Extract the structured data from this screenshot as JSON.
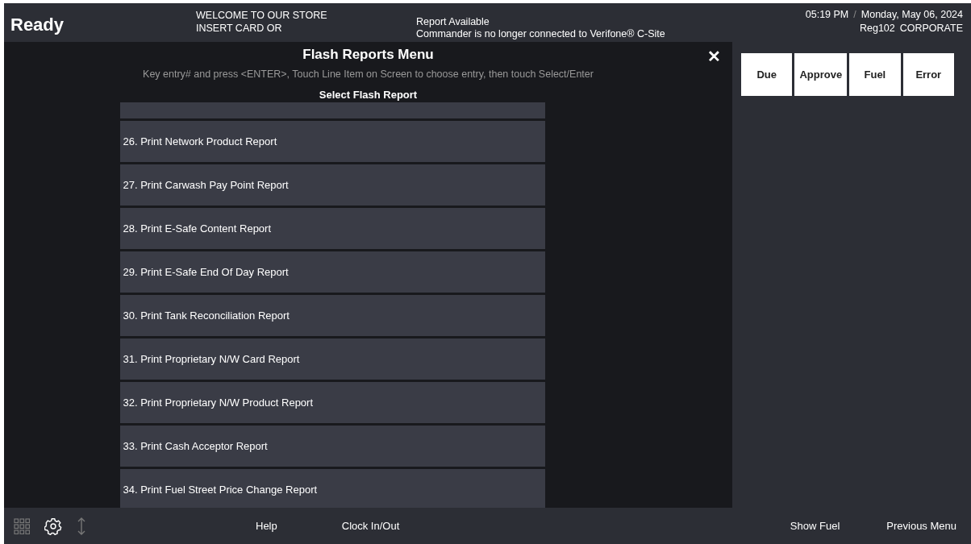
{
  "header": {
    "status": "Ready",
    "welcome_lines": [
      "WELCOME TO OUR STORE",
      "INSERT CARD OR"
    ],
    "messages": [
      "Report Available",
      "Commander is no longer connected to Verifone® C-Site"
    ],
    "time": "05:19 PM",
    "separator": "/",
    "date": "Monday, May 06, 2024",
    "register": "Reg102",
    "user": "CORPORATE"
  },
  "menu": {
    "title": "Flash Reports Menu",
    "close": "✕",
    "instructions": "Key entry# and press <ENTER>, Touch Line Item on Screen to choose entry, then touch Select/Enter",
    "subtitle": "Select Flash Report",
    "items": [
      {
        "kind": "partial"
      },
      {
        "kind": "item",
        "label": "26. Print Network Product Report"
      },
      {
        "kind": "item",
        "label": "27. Print Carwash Pay Point Report"
      },
      {
        "kind": "item",
        "label": "28. Print E-Safe Content Report"
      },
      {
        "kind": "item",
        "label": "29. Print E-Safe End Of Day Report"
      },
      {
        "kind": "item",
        "label": "30. Print Tank Reconciliation Report"
      },
      {
        "kind": "item",
        "label": "31. Print Proprietary N/W Card Report"
      },
      {
        "kind": "item",
        "label": "32. Print Proprietary N/W Product Report"
      },
      {
        "kind": "item",
        "label": "33. Print Cash Acceptor Report"
      },
      {
        "kind": "item",
        "label": "34. Print Fuel Street Price Change Report"
      }
    ]
  },
  "side_buttons": [
    "Due",
    "Approve",
    "Fuel",
    "Error"
  ],
  "footer": {
    "icons": [
      {
        "kind": "grid",
        "disabled": true
      },
      {
        "kind": "gear",
        "disabled": false
      },
      {
        "kind": "updown",
        "disabled": true
      }
    ],
    "left_buttons": [
      "Help",
      "Clock In/Out"
    ],
    "right_buttons": [
      "Show Fuel",
      "Previous Menu"
    ]
  }
}
